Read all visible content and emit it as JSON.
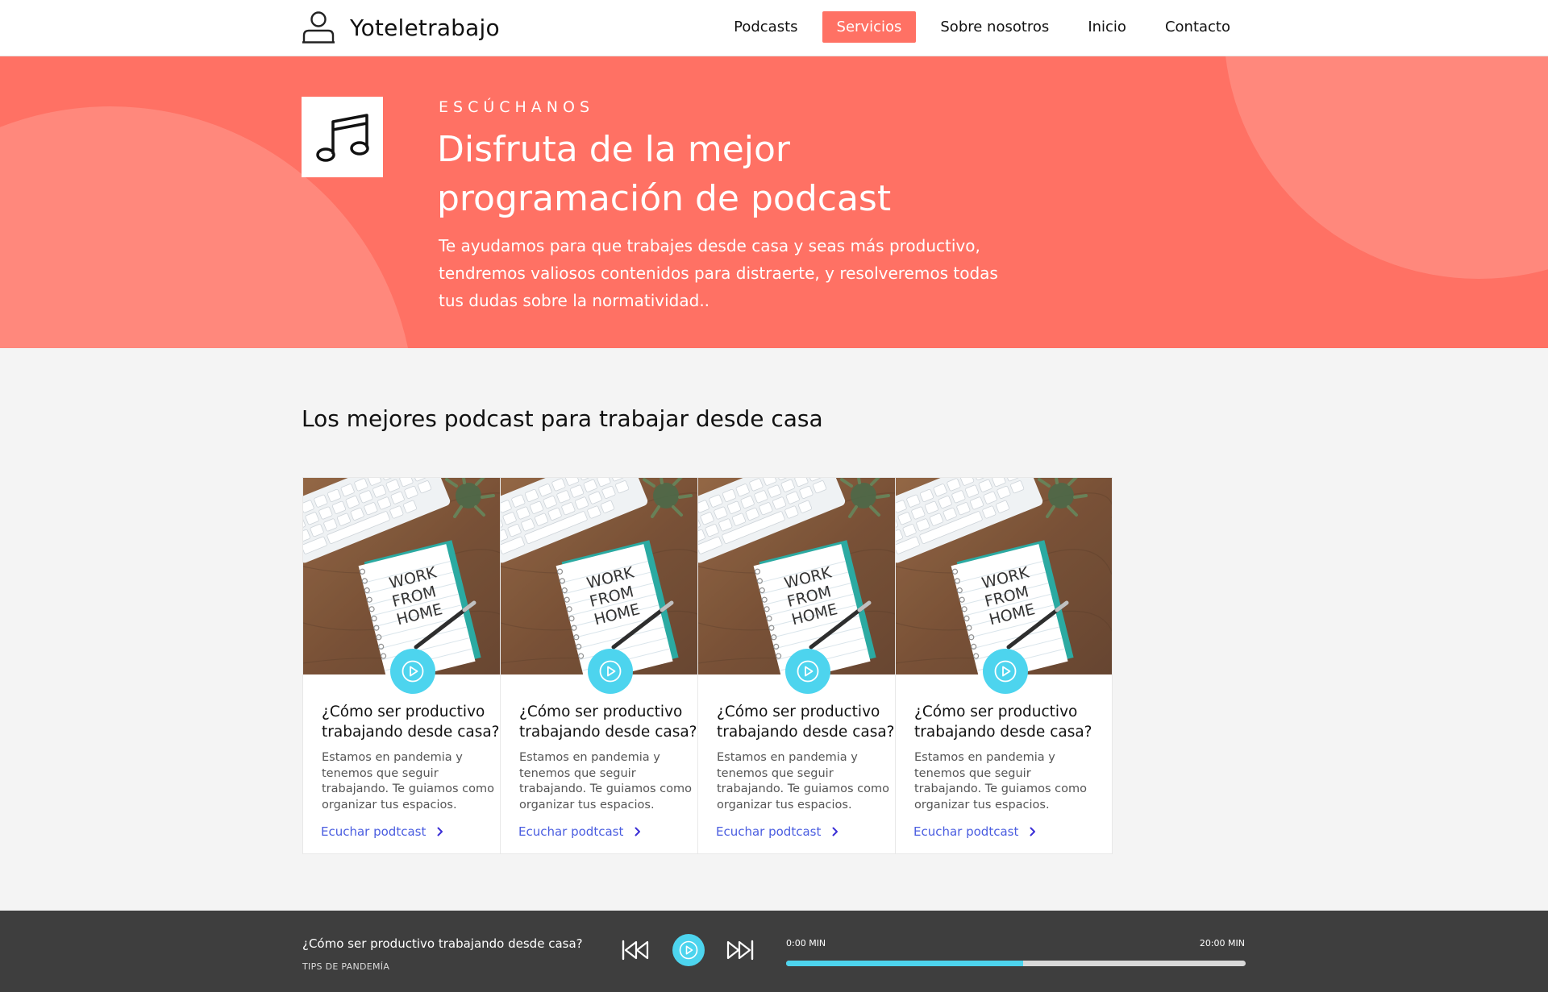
{
  "header": {
    "brand_icon": "user-icon",
    "brand_name": "Yoteletrabajo",
    "nav": [
      {
        "label": "Podcasts"
      },
      {
        "label": "Servicios",
        "active": true
      },
      {
        "label": "Sobre nosotros"
      },
      {
        "label": "Inicio"
      },
      {
        "label": "Contacto"
      }
    ]
  },
  "hero": {
    "icon": "music-note-icon",
    "eyebrow": "ESCÚCHANOS",
    "title": "Disfruta de la mejor programación de podcast",
    "text": "Te ayudamos para que trabajes desde casa y seas más productivo, tendremos valiosos contenidos para distraerte, y resolveremos todas tus dudas sobre la normatividad..",
    "colors": {
      "background": "#ff7164",
      "shape": "#ff887c"
    }
  },
  "section": {
    "title": "Los mejores podcast para trabajar desde casa"
  },
  "cards": [
    {
      "image_text": [
        "WORK",
        "FROM",
        "HOME"
      ],
      "title": "¿Cómo ser productivo trabajando desde casa?",
      "text": "Estamos en pandemia y tenemos que seguir trabajando. Te guiamos como organizar tus espacios.",
      "link": "Ecuchar podtcast"
    },
    {
      "image_text": [
        "WORK",
        "FROM",
        "HOME"
      ],
      "title": "¿Cómo ser productivo trabajando desde casa?",
      "text": "Estamos en pandemia y tenemos que seguir trabajando. Te guiamos como organizar tus espacios.",
      "link": "Ecuchar podtcast"
    },
    {
      "image_text": [
        "WORK",
        "FROM",
        "HOME"
      ],
      "title": "¿Cómo ser productivo trabajando desde casa?",
      "text": "Estamos en pandemia y tenemos que seguir trabajando. Te guiamos como organizar tus espacios.",
      "link": "Ecuchar podtcast"
    },
    {
      "image_text": [
        "WORK",
        "FROM",
        "HOME"
      ],
      "title": "¿Cómo ser productivo trabajando desde casa?",
      "text": "Estamos en pandemia y tenemos que seguir trabajando. Te guiamos como organizar tus espacios.",
      "link": "Ecuchar podtcast"
    }
  ],
  "player": {
    "title": "¿Cómo ser productivo trabajando desde casa?",
    "subtitle": "TIPS DE PANDEMÍA",
    "time_start": "0:00 MIN",
    "time_end": "20:00 MIN",
    "progress": 0.515,
    "colors": {
      "background": "#3e3e3e",
      "accent": "#4dd4ee"
    }
  }
}
